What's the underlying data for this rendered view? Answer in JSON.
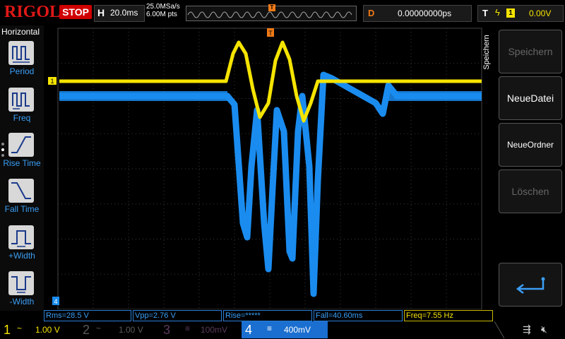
{
  "header": {
    "logo": "RIGOL",
    "run_state": "STOP",
    "timebase_letter": "H",
    "timebase": "20.0ms",
    "sample_rate": "25.0MSa/s",
    "memory_depth": "6.00M pts",
    "delay_letter": "D",
    "delay": "0.00000000ps",
    "trigger_letter": "T",
    "trigger_source": "1",
    "trigger_level": "0.00V"
  },
  "left_menu": {
    "title": "Horizontal",
    "items": [
      {
        "label": "Period"
      },
      {
        "label": "Freq"
      },
      {
        "label": "Rise Time"
      },
      {
        "label": "Fall Time"
      },
      {
        "label": "+Width"
      },
      {
        "label": "-Width"
      }
    ]
  },
  "right_menu": {
    "title": "Speichern",
    "buttons": [
      {
        "label": "Speichern",
        "enabled": false
      },
      {
        "label": "NeueDatei",
        "enabled": true
      },
      {
        "label": "NeueOrdner",
        "enabled": true
      },
      {
        "label": "Löschen",
        "enabled": false
      }
    ]
  },
  "measurements": [
    {
      "text": "Rms=28.5 V",
      "color": "blue"
    },
    {
      "text": "Vpp=2.76 V",
      "color": "blue"
    },
    {
      "text": "Rise=*****",
      "color": "blue"
    },
    {
      "text": "Fall=40.60ms",
      "color": "blue"
    },
    {
      "text": "Freq=7.55 Hz",
      "color": "yellow"
    }
  ],
  "channels": [
    {
      "num": "1",
      "coupling": "~",
      "scale": "1.00 V",
      "active": true
    },
    {
      "num": "2",
      "coupling": "~",
      "scale": "1.00 V",
      "active": false
    },
    {
      "num": "3",
      "coupling": "≡",
      "scale": "100mV",
      "active": false
    },
    {
      "num": "4",
      "coupling": "≡",
      "scale": "400mV",
      "active": true
    }
  ],
  "markers": {
    "ch1_marker": "1",
    "trigger_marker": "T",
    "ch4_marker": "4"
  },
  "colors": {
    "ch1": "#f5e400",
    "ch4": "#1a8cf0",
    "trigger": "#f07a17",
    "stop": "#d00000"
  }
}
